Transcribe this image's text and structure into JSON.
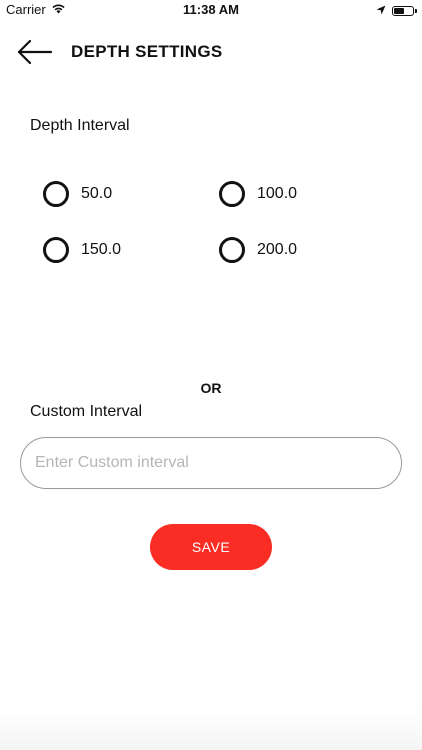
{
  "status_bar": {
    "carrier": "Carrier",
    "time": "11:38 AM"
  },
  "header": {
    "title": "DEPTH SETTINGS"
  },
  "depth_interval": {
    "label": "Depth Interval",
    "options": [
      {
        "label": "50.0",
        "selected": false
      },
      {
        "label": "100.0",
        "selected": false
      },
      {
        "label": "150.0",
        "selected": false
      },
      {
        "label": "200.0",
        "selected": false
      }
    ]
  },
  "or_label": "OR",
  "custom_interval": {
    "label": "Custom Interval",
    "placeholder": "Enter Custom interval",
    "value": ""
  },
  "save_label": "SAVE",
  "colors": {
    "accent": "#fa2d24",
    "text": "#111111",
    "placeholder": "#b5b5b5",
    "input_border": "#999999"
  }
}
